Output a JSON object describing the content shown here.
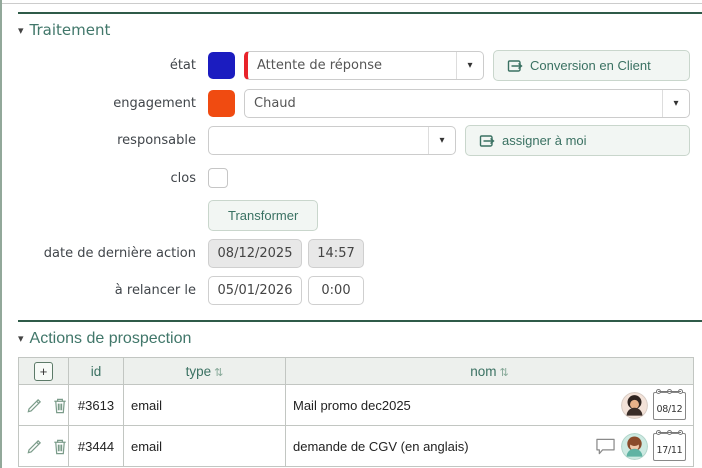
{
  "colors": {
    "accent": "#3a7162",
    "etat_swatch": "#1b1cc0",
    "engagement_swatch": "#f04b11",
    "etat_alert_border": "#e8232a"
  },
  "icons": {
    "collapse": "▾",
    "sort": "⇅",
    "add": "+"
  },
  "traitement": {
    "title": "Traitement",
    "etat_label": "état",
    "etat_value": "Attente de réponse",
    "conversion_button": "Conversion en Client",
    "engagement_label": "engagement",
    "engagement_value": "Chaud",
    "responsable_label": "responsable",
    "responsable_value": "",
    "assign_button": "assigner à moi",
    "clos_label": "clos",
    "transform_button": "Transformer",
    "last_action_label": "date de dernière action",
    "last_action_date": "08/12/2025",
    "last_action_time": "14:57",
    "relance_label": "à relancer le",
    "relance_date": "05/01/2026",
    "relance_time": "0:00"
  },
  "prospection": {
    "title": "Actions de prospection",
    "headers": {
      "id": "id",
      "type": "type",
      "nom": "nom"
    },
    "rows": [
      {
        "id": "#3613",
        "type": "email",
        "nom": "Mail promo dec2025",
        "date": "08/12"
      },
      {
        "id": "#3444",
        "type": "email",
        "nom": "demande de CGV (en anglais)",
        "date": "17/11"
      }
    ]
  }
}
